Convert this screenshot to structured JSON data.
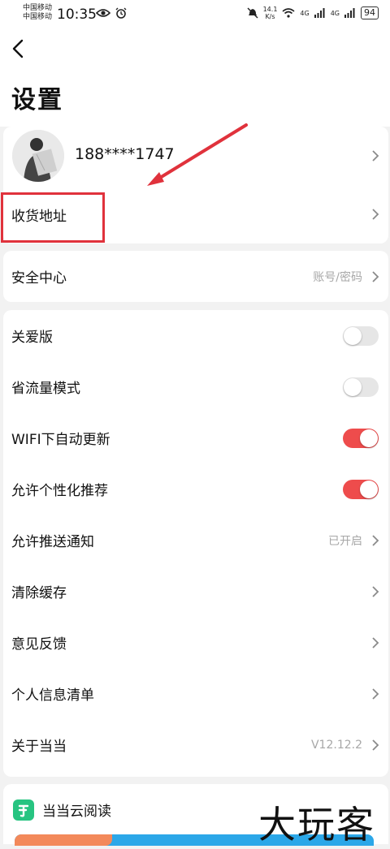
{
  "status_bar": {
    "carrier1": "中国移动",
    "carrier2": "中国移动",
    "time": "10:35",
    "speed_value": "14.1",
    "speed_unit": "K/s",
    "net1": "4G",
    "net2": "4G",
    "battery": "94"
  },
  "header": {
    "title": "设置"
  },
  "profile": {
    "phone": "188****1747"
  },
  "address": {
    "label": "收货地址"
  },
  "security": {
    "label": "安全中心",
    "value": "账号/密码"
  },
  "settings": {
    "care_mode": {
      "label": "关爱版",
      "on": false
    },
    "data_saver": {
      "label": "省流量模式",
      "on": false
    },
    "wifi_update": {
      "label": "WIFI下自动更新",
      "on": true
    },
    "personalized": {
      "label": "允许个性化推荐",
      "on": true
    },
    "push": {
      "label": "允许推送通知",
      "value": "已开启"
    },
    "clear_cache": {
      "label": "清除缓存"
    },
    "feedback": {
      "label": "意见反馈"
    },
    "personal_info": {
      "label": "个人信息清单"
    },
    "about": {
      "label": "关于当当",
      "value": "V12.12.2"
    }
  },
  "cloud": {
    "label": "当当云阅读"
  },
  "watermark": "大玩客",
  "colors": {
    "accent": "#ee4c4c",
    "highlight_box": "#e0323c",
    "cloud_icon": "#27c481"
  }
}
